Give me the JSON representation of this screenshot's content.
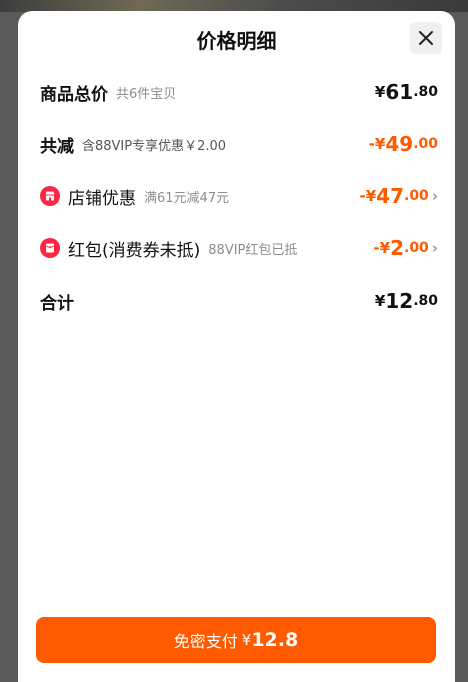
{
  "sheet": {
    "title": "价格明细",
    "close_icon": "close-icon"
  },
  "rows": {
    "total": {
      "label": "商品总价",
      "sub": "共6件宝贝",
      "currency": "¥",
      "amount_int": "61",
      "amount_dec": ".80"
    },
    "discount": {
      "label": "共减",
      "sub": "含88VIP专享优惠￥2.00",
      "prefix": "-¥",
      "amount_int": "49",
      "amount_dec": ".00"
    },
    "store_discount": {
      "icon": "store-icon",
      "label": "店铺优惠",
      "sub": "满61元减47元",
      "prefix": "-¥",
      "amount_int": "47",
      "amount_dec": ".00",
      "chevron": "›"
    },
    "red_packet": {
      "icon": "red-packet-icon",
      "label": "红包(消费券未抵)",
      "sub": "88VIP红包已抵",
      "prefix": "-¥",
      "amount_int": "2",
      "amount_dec": ".00",
      "chevron": "›"
    },
    "subtotal": {
      "label": "合计",
      "currency": "¥",
      "amount_int": "12",
      "amount_dec": ".80"
    }
  },
  "pay_button": {
    "label": "免密支付",
    "currency": "¥",
    "amount": "12.8"
  },
  "colors": {
    "accent": "#ff5a00",
    "icon_red": "#ff2442"
  }
}
